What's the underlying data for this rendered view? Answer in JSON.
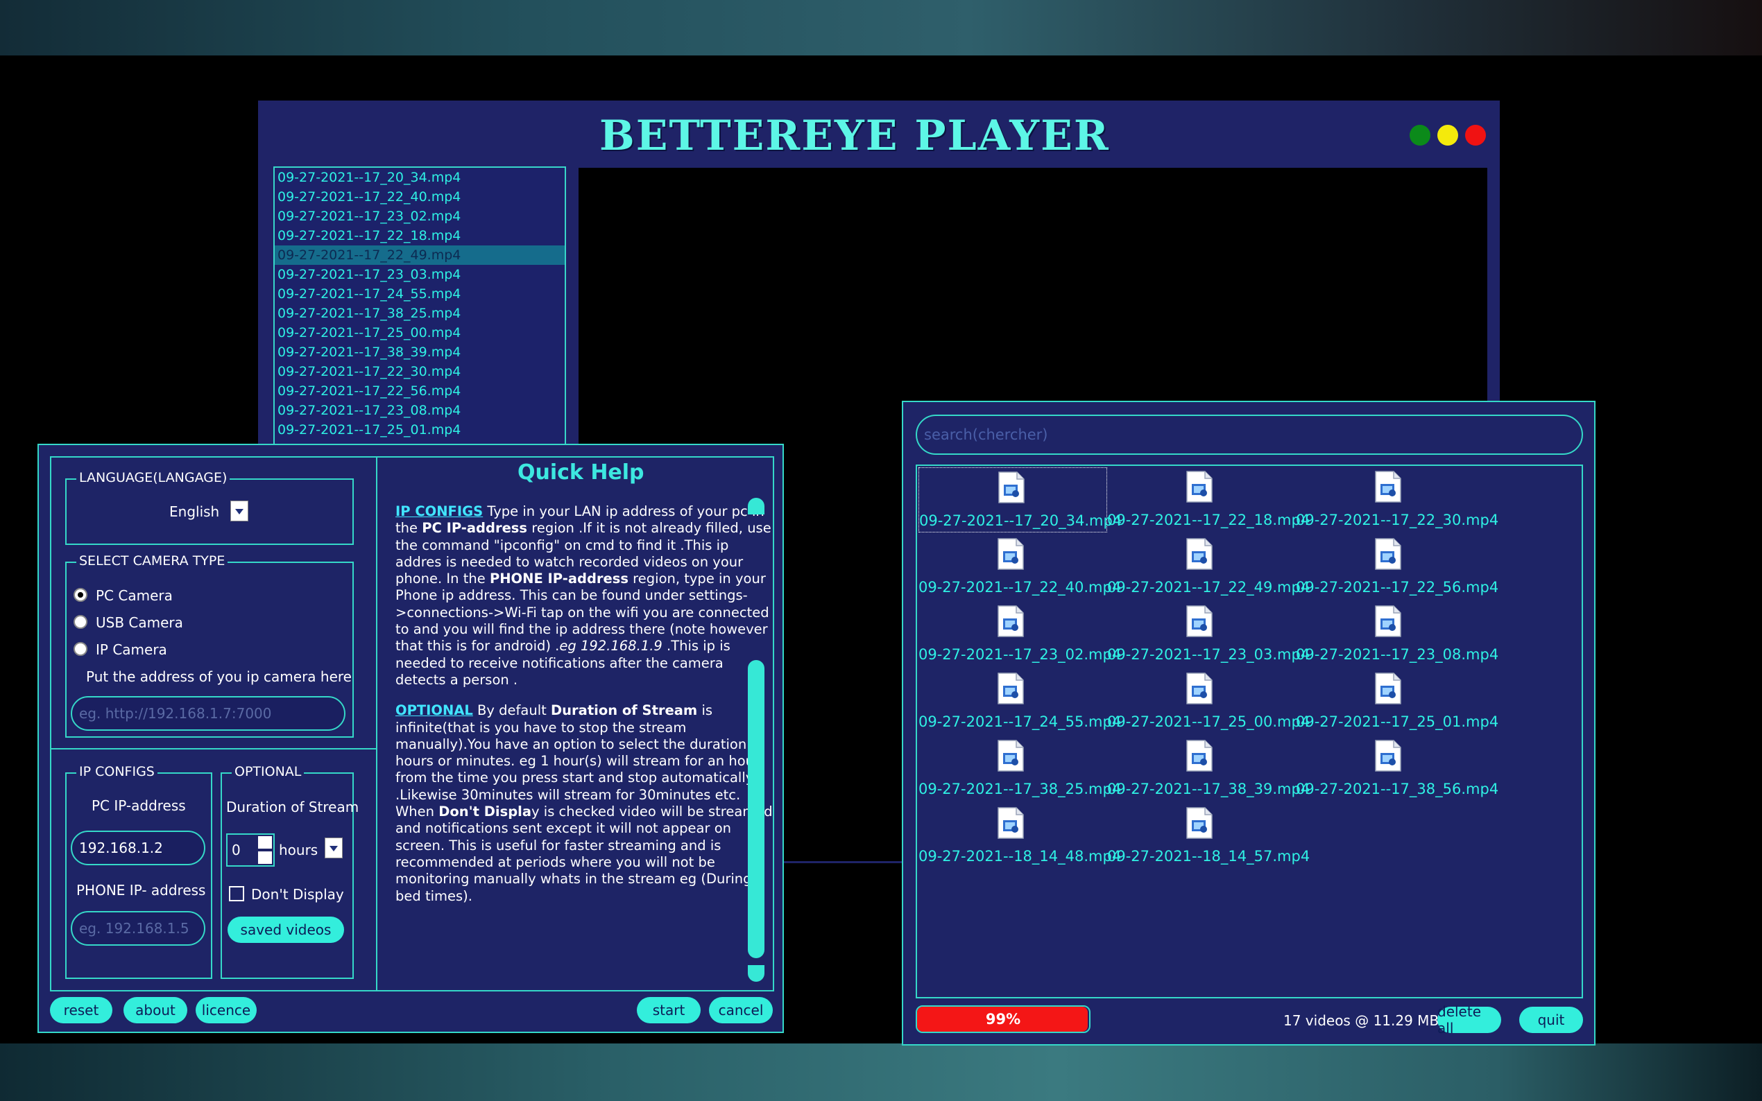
{
  "player": {
    "title": "BETTEREYE PLAYER",
    "list": [
      "09-27-2021--17_20_34.mp4",
      "09-27-2021--17_22_40.mp4",
      "09-27-2021--17_23_02.mp4",
      "09-27-2021--17_22_18.mp4",
      "09-27-2021--17_22_49.mp4",
      "09-27-2021--17_23_03.mp4",
      "09-27-2021--17_24_55.mp4",
      "09-27-2021--17_38_25.mp4",
      "09-27-2021--17_25_00.mp4",
      "09-27-2021--17_38_39.mp4",
      "09-27-2021--17_22_30.mp4",
      "09-27-2021--17_22_56.mp4",
      "09-27-2021--17_23_08.mp4",
      "09-27-2021--17_25_01.mp4"
    ],
    "selected_index": 4
  },
  "settings": {
    "language_legend": "LANGUAGE(LANGAGE)",
    "language_value": "English",
    "camera_legend": "SELECT CAMERA TYPE",
    "camera_options": [
      "PC Camera",
      "USB Camera",
      "IP Camera"
    ],
    "camera_selected": 0,
    "ip_camera_hint": "Put the address of  you ip camera here",
    "ip_camera_placeholder": "eg. http://192.168.1.7:7000",
    "ip_configs_legend": "IP CONFIGS",
    "pc_ip_label": "PC IP-address",
    "pc_ip_value": "192.168.1.2",
    "phone_ip_label": "PHONE IP- address",
    "phone_ip_placeholder": "eg. 192.168.1.5",
    "optional_legend": "OPTIONAL",
    "duration_label": "Duration of Stream",
    "duration_value": "0",
    "duration_unit": "hours",
    "dont_display_label": "Don't Display",
    "saved_videos_button": "saved videos",
    "buttons": {
      "reset": "reset",
      "about": "about",
      "licence": "licence",
      "start": "start",
      "cancel": "cancel"
    },
    "help_title": "Quick Help",
    "help": {
      "p1_head": "IP CONFIGS",
      "p1_a": "    Type in your LAN ip address of your pc in the ",
      "p1_b": "PC IP-address",
      "p1_c": " region .If it is not already filled, use the command \"ipconfig\"  on cmd to find it .This ip addres is needed to watch recorded videos on your phone.    In the       ",
      "p1_d": "PHONE IP-address",
      "p1_e": " region, type in  your Phone ip address. This can be found under  settings->connections->Wi-Fi tap on the wifi you are connected to and you will find the ip address there (note however that this is for android) .",
      "p1_f": "eg 192.168.1.9 ",
      "p1_g": ".This ip is needed to receive  notifications after the camera detects a person .",
      "p2_head": "OPTIONAL",
      "p2_a": "    By default   ",
      "p2_b": "Duration of Stream",
      "p2_c": " is infinite(that is you have to stop the stream manually).You have an option to select the duration in hours or minutes. eg 1 hour(s) will stream for an hour from the time you press start and stop automatically .Likewise 30minutes will stream for 30minutes  etc. When ",
      "p2_d": "Don't Displa",
      "p2_e": "y is checked video will be streamed and notifications sent except it will not appear on screen. This is useful for faster streaming and is recommended at periods where you will not be monitoring manually whats in the stream eg (During bed times)."
    }
  },
  "saved": {
    "search_placeholder": "search(chercher)",
    "files": [
      "09-27-2021--17_20_34.mp4",
      "09-27-2021--17_22_18.mp4",
      "09-27-2021--17_22_30.mp4",
      "09-27-2021--17_22_40.mp4",
      "09-27-2021--17_22_49.mp4",
      "09-27-2021--17_22_56.mp4",
      "09-27-2021--17_23_02.mp4",
      "09-27-2021--17_23_03.mp4",
      "09-27-2021--17_23_08.mp4",
      "09-27-2021--17_24_55.mp4",
      "09-27-2021--17_25_00.mp4",
      "09-27-2021--17_25_01.mp4",
      "09-27-2021--17_38_25.mp4",
      "09-27-2021--17_38_39.mp4",
      "09-27-2021--17_38_56.mp4",
      "09-27-2021--18_14_48.mp4",
      "09-27-2021--18_14_57.mp4"
    ],
    "selected_index": 0,
    "progress_text": "99%",
    "progress_value": 0.99,
    "count_text": "17 videos @ 11.29 MB",
    "delete_all": "delete all",
    "quit": "quit"
  },
  "colors": {
    "accent": "#35d8c8",
    "panel": "#1e2466",
    "progress": "#f41616"
  }
}
